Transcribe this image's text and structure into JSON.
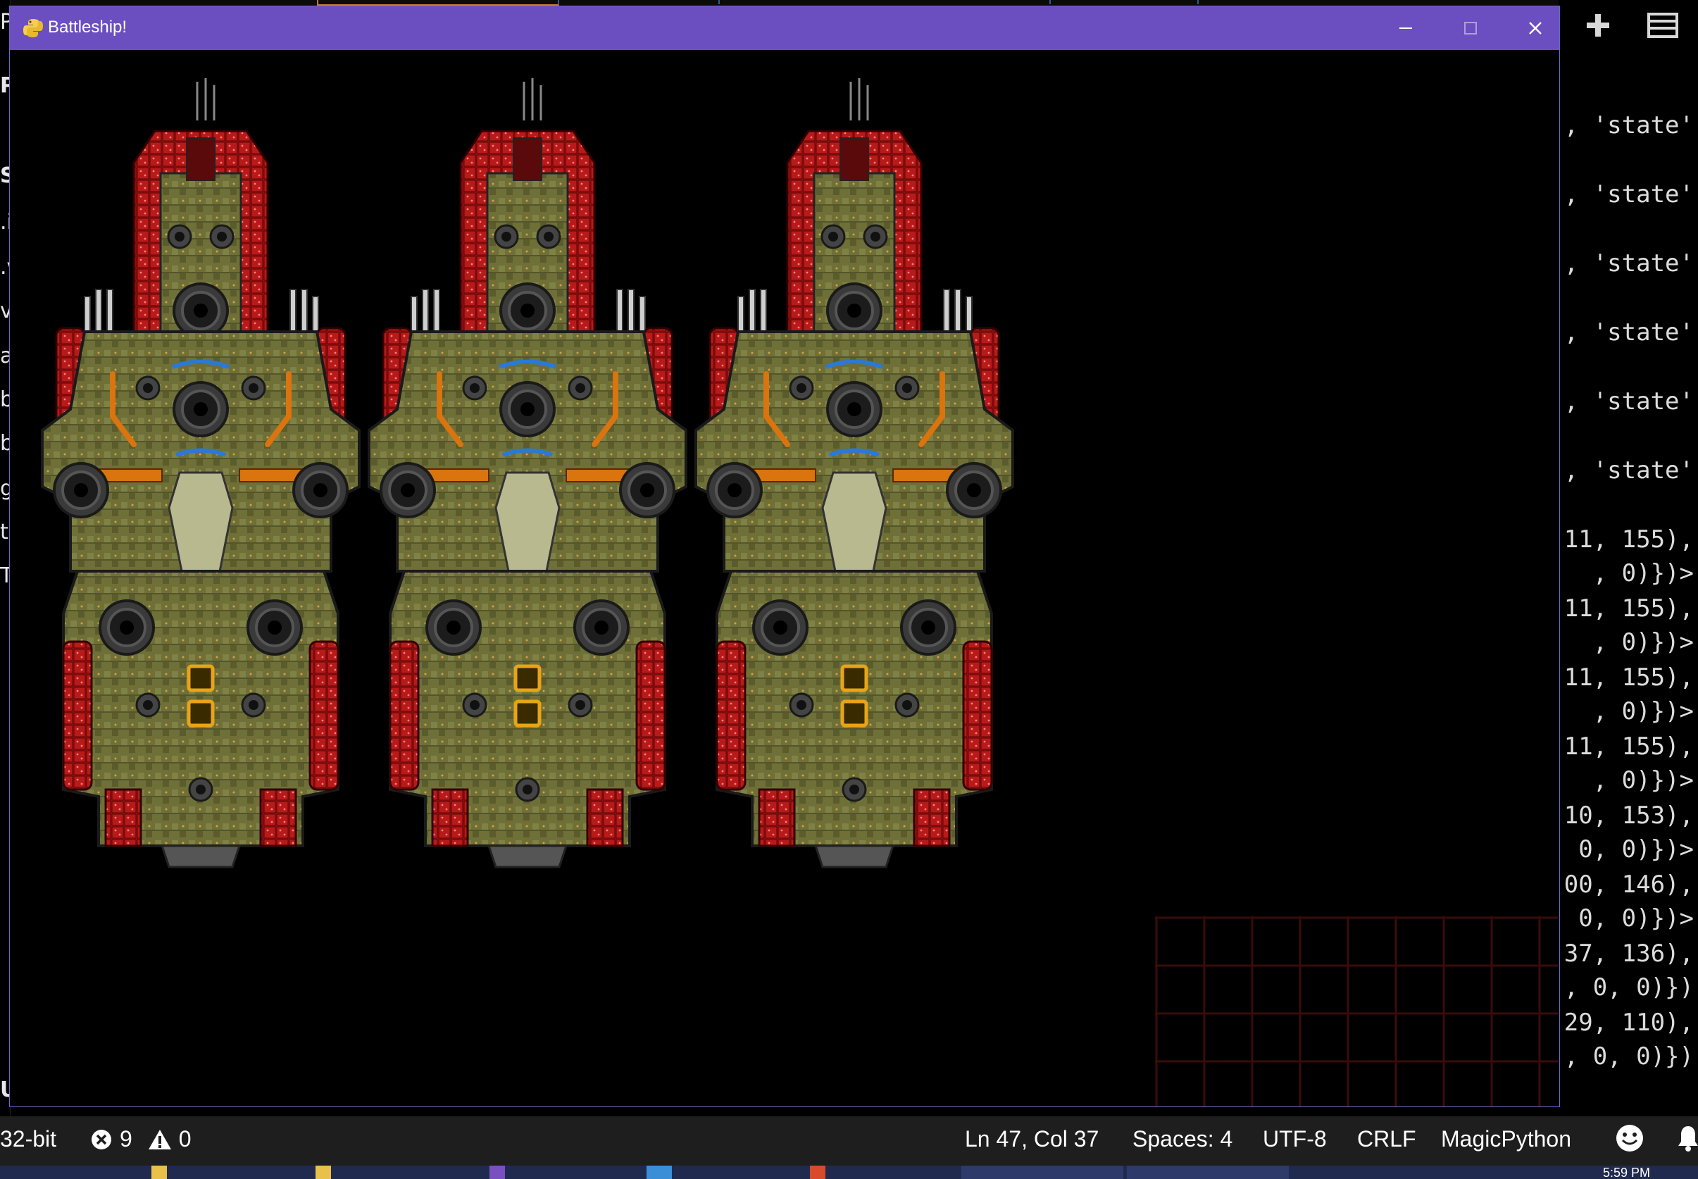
{
  "window": {
    "title": "Battleship!",
    "buttons": {
      "minimize": "—",
      "maximize": "☐",
      "close": "✕"
    }
  },
  "editor": {
    "sidebar_fragments": [
      "P",
      "PE",
      "S",
      ".i",
      ".v",
      "v",
      "a",
      "b",
      "b",
      "g",
      "t",
      "T",
      "U"
    ],
    "code_lines": [
      ", 'state'",
      ", 'state'",
      ", 'state'",
      ", 'state'",
      ", 'state'",
      ", 'state'",
      "11, 155),",
      ", 0)})>",
      "11, 155),",
      ", 0)})>",
      "11, 155),",
      ", 0)})>",
      "11, 155),",
      ", 0)})>",
      "10, 153),",
      "0, 0)})>",
      "00, 146),",
      " 0, 0)})>",
      "37, 136),",
      ", 0, 0)})",
      "29, 110),",
      ", 0, 0)})"
    ],
    "actions": {
      "add_icon": "plus-icon",
      "split_icon": "layout-icon"
    }
  },
  "status_bar": {
    "interpreter": "32-bit",
    "errors": "9",
    "warnings": "0",
    "position": "Ln 47, Col 37",
    "indent": "Spaces: 4",
    "encoding": "UTF-8",
    "eol": "CRLF",
    "language": "MagicPython"
  },
  "taskbar": {
    "clock": "5:59 PM"
  },
  "colors": {
    "titlebar": "#6b4fc0",
    "canvas": "#000000",
    "statusbar": "#1e1e1e",
    "hull_red": "#a01010",
    "hull_olive": "#6e7038",
    "accent_orange": "#d9740f",
    "accent_blue": "#2a78d8",
    "grid_line": "#3a0c0c"
  },
  "game": {
    "ships": [
      "ship-1",
      "ship-2",
      "ship-3"
    ]
  }
}
